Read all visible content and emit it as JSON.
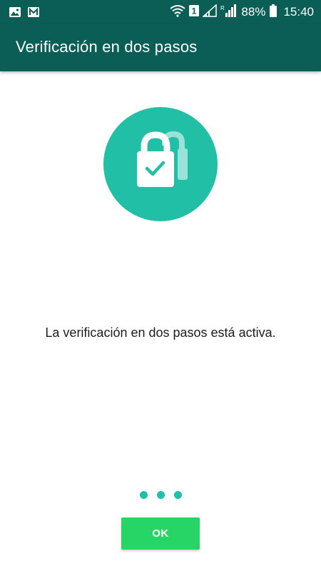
{
  "status_bar": {
    "left_icons": [
      "image-icon",
      "gmail-icon"
    ],
    "sim_badge": "1",
    "signal_label": "R",
    "battery_percent": "88%",
    "time": "15:40"
  },
  "app_bar": {
    "title": "Verificación en dos pasos"
  },
  "hero": {
    "icon": "padlock-check-icon",
    "color": "#20bfa6"
  },
  "message": "La verificación en dos pasos está activa.",
  "pager": {
    "count": 3
  },
  "ok_button": {
    "label": "OK",
    "color": "#27d466"
  },
  "colors": {
    "primary_dark": "#0b5e55",
    "accent": "#20bfa6"
  }
}
